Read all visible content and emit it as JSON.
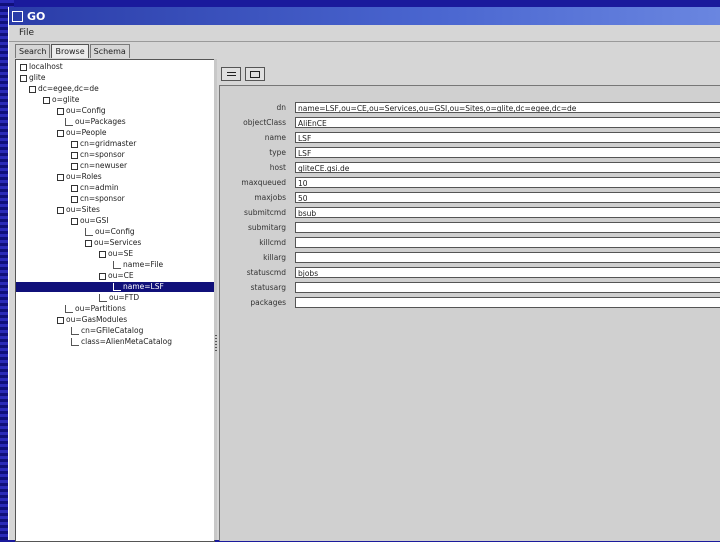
{
  "window": {
    "title": "GO"
  },
  "menu": {
    "file": "File"
  },
  "tabs": [
    "Search",
    "Browse",
    "Schema"
  ],
  "tree": [
    {
      "label": "localhost"
    },
    {
      "label": "glite"
    },
    {
      "label": "dc=egee,dc=de"
    },
    {
      "label": "o=glite"
    },
    {
      "label": "ou=Config"
    },
    {
      "label": "ou=Packages"
    },
    {
      "label": "ou=People"
    },
    {
      "label": "cn=gridmaster"
    },
    {
      "label": "cn=sponsor"
    },
    {
      "label": "cn=newuser"
    },
    {
      "label": "ou=Roles"
    },
    {
      "label": "cn=admin"
    },
    {
      "label": "cn=sponsor"
    },
    {
      "label": "ou=Sites"
    },
    {
      "label": "ou=GSI"
    },
    {
      "label": "ou=Config"
    },
    {
      "label": "ou=Services"
    },
    {
      "label": "ou=SE"
    },
    {
      "label": "name=File"
    },
    {
      "label": "ou=CE"
    },
    {
      "label": "name=LSF"
    },
    {
      "label": "ou=FTD"
    },
    {
      "label": "ou=Partitions"
    },
    {
      "label": "ou=GasModules"
    },
    {
      "label": "cn=GFileCatalog"
    },
    {
      "label": "class=AlienMetaCatalog"
    }
  ],
  "toolbar": {
    "btn1": "list-icon",
    "btn2": "window-icon"
  },
  "form": [
    {
      "label": "dn",
      "value": "name=LSF,ou=CE,ou=Services,ou=GSI,ou=Sites,o=glite,dc=egee,dc=de"
    },
    {
      "label": "objectClass",
      "value": "AliEnCE"
    },
    {
      "label": "name",
      "value": "LSF"
    },
    {
      "label": "type",
      "value": "LSF"
    },
    {
      "label": "host",
      "value": "gliteCE.gsi.de"
    },
    {
      "label": "maxqueued",
      "value": "10"
    },
    {
      "label": "maxjobs",
      "value": "50"
    },
    {
      "label": "submitcmd",
      "value": "bsub"
    },
    {
      "label": "submitarg",
      "value": ""
    },
    {
      "label": "killcmd",
      "value": ""
    },
    {
      "label": "killarg",
      "value": ""
    },
    {
      "label": "statuscmd",
      "value": "bjobs"
    },
    {
      "label": "statusarg",
      "value": ""
    },
    {
      "label": "packages",
      "value": ""
    }
  ]
}
